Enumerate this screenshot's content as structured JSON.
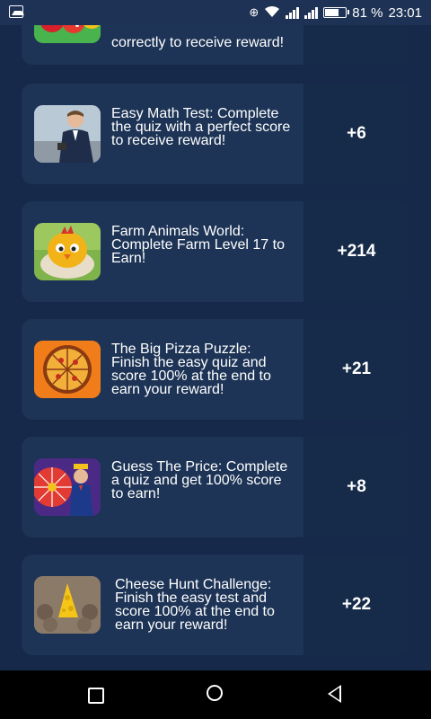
{
  "status_bar": {
    "battery_pct": "81 %",
    "time": "23:01",
    "battery_level": 0.81
  },
  "offers": [
    {
      "name": "fruit-quiz",
      "description": "correctly to receive reward!",
      "reward": ""
    },
    {
      "name": "easy-math-test",
      "description": "Easy Math Test: Complete the quiz with a perfect score to receive reward!",
      "reward": "+6"
    },
    {
      "name": "farm-animals-world",
      "description": "Farm Animals World: Complete Farm Level 17 to Earn!",
      "reward": "+214"
    },
    {
      "name": "big-pizza-puzzle",
      "description": "The Big Pizza Puzzle: Finish the easy quiz and score 100% at the end to earn your reward!",
      "reward": "+21"
    },
    {
      "name": "guess-the-price",
      "description": "Guess The Price: Complete a quiz and get 100% score to earn!",
      "reward": "+8"
    },
    {
      "name": "cheese-hunt-challenge",
      "description": "Cheese Hunt Challenge: Finish the easy test and score 100% at the end to earn your reward!",
      "reward": "+22"
    }
  ],
  "icons": {
    "status_left": "image-icon",
    "status_right": [
      "data-saver-icon",
      "wifi-icon",
      "signal-icon",
      "signal-icon",
      "battery-icon"
    ],
    "nav": [
      "recent-apps-icon",
      "home-icon",
      "back-icon"
    ]
  }
}
